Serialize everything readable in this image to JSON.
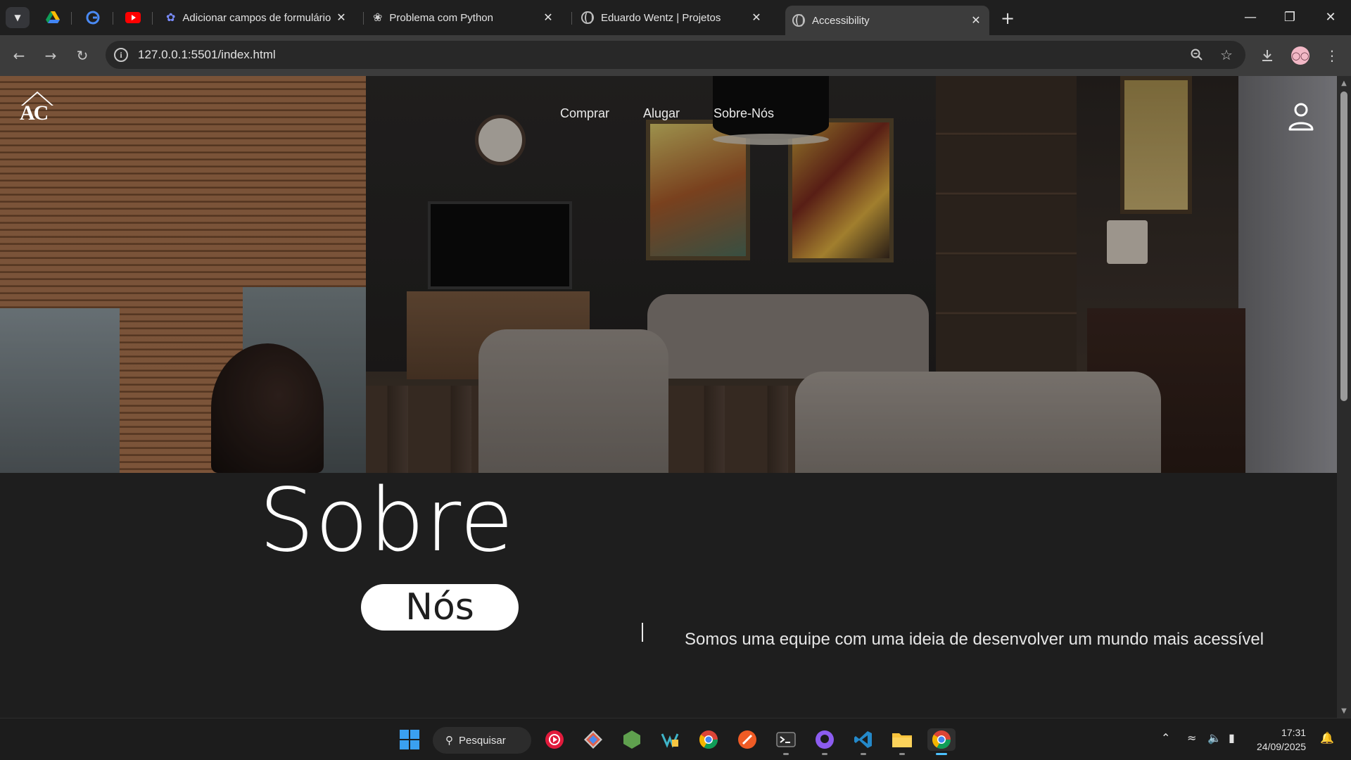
{
  "browser": {
    "tabs": [
      {
        "title": "Adicionar campos de formulário",
        "icon": "feather-icon",
        "active": false
      },
      {
        "title": "Problema com Python",
        "icon": "openai-icon",
        "active": false
      },
      {
        "title": "Eduardo Wentz | Projetos",
        "icon": "globe-icon",
        "active": false
      },
      {
        "title": "Accessibility",
        "icon": "globe-icon",
        "active": true
      }
    ],
    "pinned": [
      "google-drive-icon",
      "grammarly-icon",
      "youtube-icon"
    ],
    "url": "127.0.0.1:5501/index.html"
  },
  "page": {
    "logo": "AC",
    "nav": [
      "Comprar",
      "Alugar",
      "Sobre-Nós"
    ],
    "heading": "Sobre",
    "heading_pill": "Nós",
    "about_text": "Somos uma equipe com uma ideia de desenvolver um mundo mais acessível"
  },
  "taskbar": {
    "search_label": "Pesquisar",
    "time": "17:31",
    "date": "24/09/2025"
  },
  "colors": {
    "page_bg": "#1e1e1e",
    "chrome_bg": "#1f1f1f",
    "toolbar_bg": "#3c3c3c"
  }
}
